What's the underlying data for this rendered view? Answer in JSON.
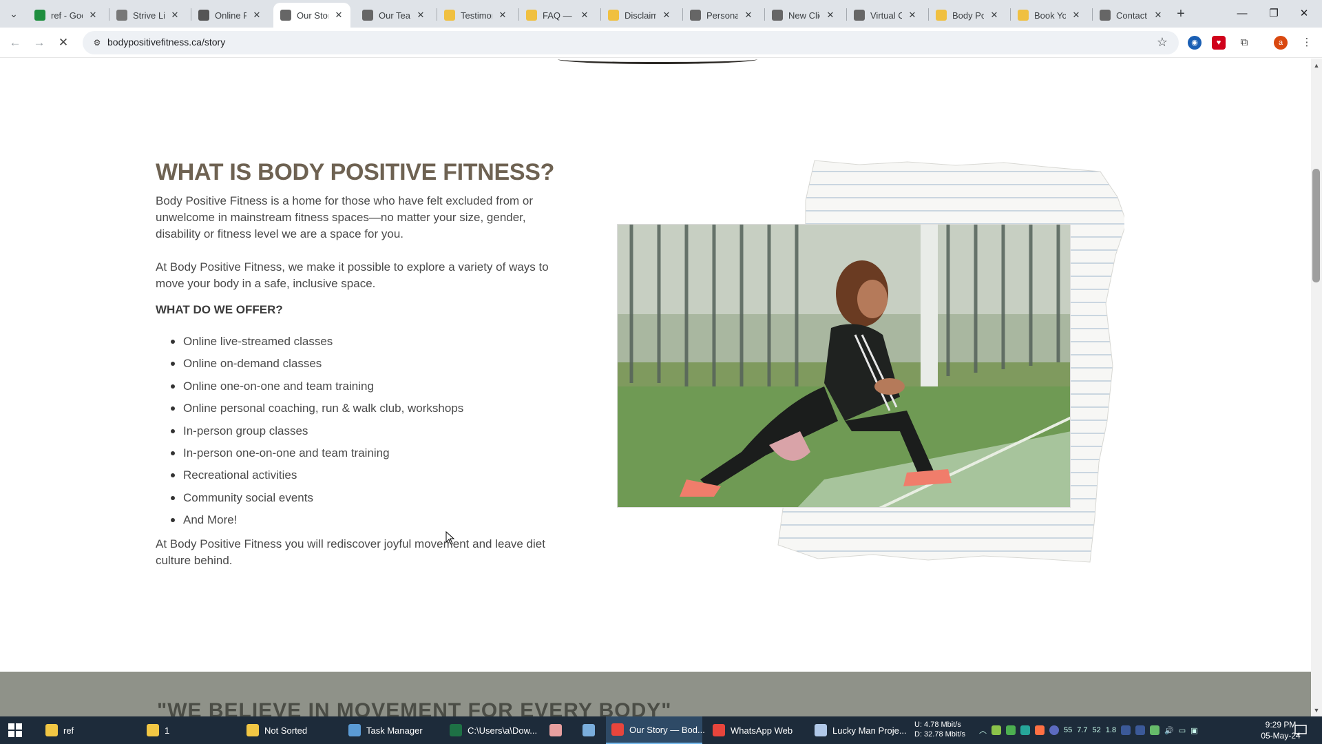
{
  "browser": {
    "tabs": [
      {
        "label": "ref - Goo",
        "icon": "sheets-icon",
        "color": "#1e8e3e"
      },
      {
        "label": "Strive Lif",
        "icon": "strive-favicon-icon",
        "color": "#777"
      },
      {
        "label": "Online F",
        "icon": "check-favicon-icon",
        "color": "#555"
      },
      {
        "label": "Our Story",
        "icon": "loading-spinner-icon",
        "color": "#666",
        "active": true
      },
      {
        "label": "Our Tean",
        "icon": "loading-spinner-icon",
        "color": "#666"
      },
      {
        "label": "Testimon",
        "icon": "hand-favicon-icon",
        "color": "#f0c040"
      },
      {
        "label": "FAQ — B",
        "icon": "hand-favicon-icon",
        "color": "#f0c040"
      },
      {
        "label": "Disclaim",
        "icon": "hand-favicon-icon",
        "color": "#f0c040"
      },
      {
        "label": "Personal",
        "icon": "loading-spinner-icon",
        "color": "#666"
      },
      {
        "label": "New Clie",
        "icon": "loading-spinner-icon",
        "color": "#666"
      },
      {
        "label": "Virtual C",
        "icon": "loading-spinner-icon",
        "color": "#666"
      },
      {
        "label": "Body Pos",
        "icon": "hand-favicon-icon",
        "color": "#f0c040"
      },
      {
        "label": "Book You",
        "icon": "hand-favicon-icon",
        "color": "#f0c040"
      },
      {
        "label": "Contact",
        "icon": "loading-spinner-icon",
        "color": "#666"
      }
    ],
    "url": "bodypositivefitness.ca/story"
  },
  "content": {
    "heading": "WHAT IS BODY POSITIVE FITNESS?",
    "intro": "Body Positive Fitness is a home for those who have felt excluded from or unwelcome in mainstream fitness spaces—no matter your size, gender, disability or fitness level we are a space for you.",
    "explore": "At Body Positive Fitness, we make it possible to explore a variety of ways to move your body in a safe, inclusive space.",
    "offer_heading": "WHAT DO WE OFFER?",
    "offers": [
      "Online live-streamed classes",
      "Online on-demand classes",
      "Online one-on-one and team training",
      "Online personal coaching, run & walk club, workshops",
      "In-person group classes",
      "In-person one-on-one and team training",
      "Recreational activities",
      "Community social events",
      "And More!"
    ],
    "closing": "At Body Positive Fitness you will rediscover joyful movement and leave diet culture behind.",
    "band_text": "\"WE BELIEVE IN MOVEMENT FOR EVERY BODY\""
  },
  "taskbar": {
    "items": [
      {
        "label": "ref",
        "icon": "folder-icon",
        "color": "#f2c744"
      },
      {
        "label": "1",
        "icon": "folder-icon",
        "color": "#f2c744"
      },
      {
        "label": "Not Sorted",
        "icon": "folder-icon",
        "color": "#f2c744"
      },
      {
        "label": "Task Manager",
        "icon": "task-manager-icon",
        "color": "#5b9bd5"
      },
      {
        "label": "C:\\Users\\a\\Dow...",
        "icon": "excel-icon",
        "color": "#1e7145"
      },
      {
        "label": "",
        "icon": "app-icon",
        "color": "#e8a0a0"
      },
      {
        "label": "",
        "icon": "notepad-icon",
        "color": "#7aaedc"
      },
      {
        "label": "Our Story — Bod...",
        "icon": "chrome-icon",
        "color": "#e8453c",
        "active": true
      },
      {
        "label": "WhatsApp Web",
        "icon": "chrome-icon",
        "color": "#e8453c"
      },
      {
        "label": "Lucky Man Proje...",
        "icon": "visual-studio-icon",
        "color": "#b0c8e8"
      }
    ],
    "net_up": "U:   4.78 Mbit/s",
    "net_down": "D:  32.78 Mbit/s",
    "tray_values": [
      "55",
      "7.7",
      "52",
      "1.8"
    ],
    "time": "9:29 PM",
    "date": "05-May-24"
  }
}
